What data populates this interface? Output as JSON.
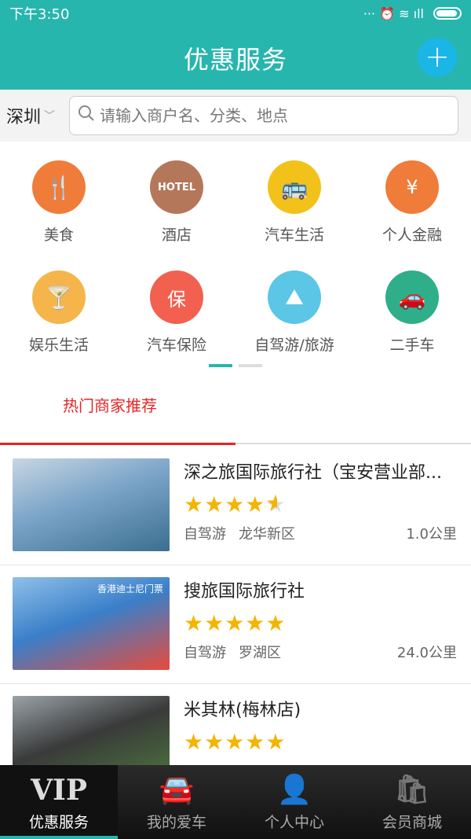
{
  "status_bar": {
    "time": "下午3:50",
    "icons_text": "··· ⏰ ≋ ıll"
  },
  "header": {
    "title": "优惠服务",
    "add_label": "+"
  },
  "search": {
    "city": "深圳",
    "placeholder": "请输入商户名、分类、地点"
  },
  "categories": [
    {
      "label": "美食",
      "icon": "fork-knife-icon",
      "color": "#f07c3a",
      "glyph": "🍴"
    },
    {
      "label": "酒店",
      "icon": "hotel-icon",
      "color": "#b5775a",
      "glyph": "HOTEL"
    },
    {
      "label": "汽车生活",
      "icon": "bus-icon",
      "color": "#f2c21b",
      "glyph": "🚌"
    },
    {
      "label": "个人金融",
      "icon": "coupon-yen-icon",
      "color": "#f07c3a",
      "glyph": "¥"
    },
    {
      "label": "娱乐生活",
      "icon": "cocktail-icon",
      "color": "#f5b54a",
      "glyph": "🍸"
    },
    {
      "label": "汽车保险",
      "icon": "insurance-icon",
      "color": "#f26050",
      "glyph": "保"
    },
    {
      "label": "自驾游/旅游",
      "icon": "map-icon",
      "color": "#5bc6e6",
      "glyph": "⛰"
    },
    {
      "label": "二手车",
      "icon": "used-car-icon",
      "color": "#2fae8a",
      "glyph": "🚗"
    }
  ],
  "pager": {
    "pages": 2,
    "active": 0
  },
  "section": {
    "tab_label": "热门商家推荐"
  },
  "merchants": [
    {
      "name": "深之旅国际旅行社（宝安营业部...",
      "rating": 4.5,
      "stars_full": "★★★★",
      "stars_half": "★",
      "category": "自驾游",
      "district": "龙华新区",
      "distance": "1.0公里",
      "thumb_colors": [
        "#7aa4c8",
        "#c7d6e2",
        "#3b6f8f"
      ]
    },
    {
      "name": "搜旅国际旅行社",
      "rating": 5,
      "stars_full": "★★★★★",
      "stars_half": "",
      "category": "自驾游",
      "district": "罗湖区",
      "distance": "24.0公里",
      "thumb_text": "香港迪士尼门票",
      "thumb_colors": [
        "#3a7fc9",
        "#8fc0e8",
        "#e84b3c"
      ]
    },
    {
      "name": "米其林(梅林店)",
      "rating": 5,
      "stars_full": "★★★★★",
      "stars_half": "",
      "category": "",
      "district": "",
      "distance": "",
      "thumb_colors": [
        "#3a3a3a",
        "#9aa3a8",
        "#4c7a3d"
      ]
    }
  ],
  "tabbar": [
    {
      "label": "优惠服务",
      "icon": "vip-icon",
      "glyph": "VIP",
      "active": true
    },
    {
      "label": "我的爱车",
      "icon": "car-icon",
      "glyph": "🚘",
      "active": false
    },
    {
      "label": "个人中心",
      "icon": "person-icon",
      "glyph": "👤",
      "active": false
    },
    {
      "label": "会员商城",
      "icon": "shopping-bag-icon",
      "glyph": "🛍",
      "active": false
    }
  ]
}
